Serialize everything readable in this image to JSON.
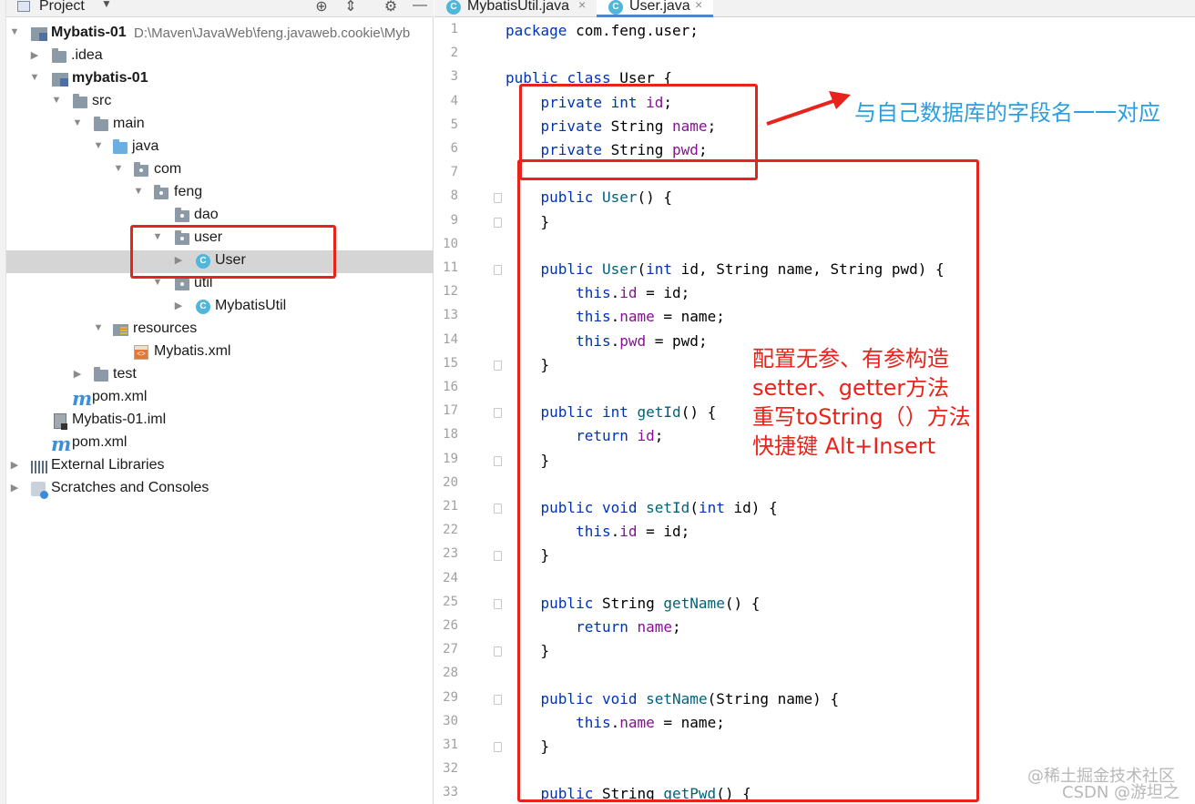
{
  "project_panel": {
    "title": "Project",
    "tree": [
      {
        "label": "Mybatis-01",
        "path": "D:\\Maven\\JavaWeb\\feng.javaweb.cookie\\Myb"
      },
      {
        "label": ".idea"
      },
      {
        "label": "mybatis-01"
      },
      {
        "label": "src"
      },
      {
        "label": "main"
      },
      {
        "label": "java"
      },
      {
        "label": "com"
      },
      {
        "label": "feng"
      },
      {
        "label": "dao"
      },
      {
        "label": "user"
      },
      {
        "label": "User"
      },
      {
        "label": "util"
      },
      {
        "label": "MybatisUtil"
      },
      {
        "label": "resources"
      },
      {
        "label": "Mybatis.xml"
      },
      {
        "label": "test"
      },
      {
        "label": "pom.xml"
      },
      {
        "label": "Mybatis-01.iml"
      },
      {
        "label": "pom.xml"
      },
      {
        "label": "External Libraries"
      },
      {
        "label": "Scratches and Consoles"
      }
    ]
  },
  "editor": {
    "tabs": [
      {
        "label": "MybatisUtil.java",
        "close": "×",
        "icon": "C"
      },
      {
        "label": "User.java",
        "close": "×",
        "icon": "C"
      }
    ],
    "line_numbers": [
      "1",
      "2",
      "3",
      "4",
      "5",
      "6",
      "7",
      "8",
      "9",
      "10",
      "11",
      "12",
      "13",
      "14",
      "15",
      "16",
      "17",
      "18",
      "19",
      "20",
      "21",
      "22",
      "23",
      "24",
      "25",
      "26",
      "27",
      "28",
      "29",
      "30",
      "31",
      "32",
      "33"
    ],
    "code": [
      "package com.feng.user;",
      "",
      "public class User {",
      "    private int id;",
      "    private String name;",
      "    private String pwd;",
      "",
      "    public User() {",
      "    }",
      "",
      "    public User(int id, String name, String pwd) {",
      "        this.id = id;",
      "        this.name = name;",
      "        this.pwd = pwd;",
      "    }",
      "",
      "    public int getId() {",
      "        return id;",
      "    }",
      "",
      "    public void setId(int id) {",
      "        this.id = id;",
      "    }",
      "",
      "    public String getName() {",
      "        return name;",
      "    }",
      "",
      "    public void setName(String name) {",
      "        this.name = name;",
      "    }",
      "",
      "    public String getPwd() {"
    ]
  },
  "annotations": {
    "fields_note": "与自己数据库的字段名一一对应",
    "methods_note": [
      "配置无参、有参构造",
      "setter、getter方法",
      "重写toString（）方法",
      "快捷键 Alt+Insert"
    ],
    "watermark_1": "@稀土掘金技术社区",
    "watermark_2": "CSDN @游坦之"
  },
  "colors": {
    "keyword": "#0033b3",
    "field": "#871094",
    "method": "#00627a",
    "annotation_red": "#e8231c",
    "annotation_blue": "#2a9fe0"
  }
}
